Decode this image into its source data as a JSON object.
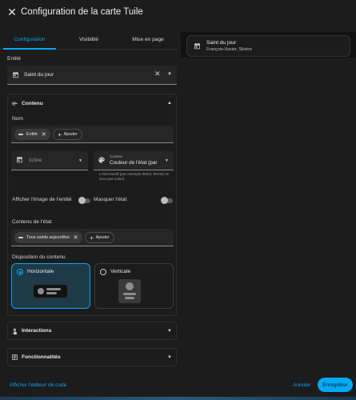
{
  "dialog": {
    "title": "Configuration de la carte Tuile",
    "close_icon": "close-icon"
  },
  "tabs": [
    {
      "label": "Configuration",
      "active": true
    },
    {
      "label": "Visibilité",
      "active": false
    },
    {
      "label": "Mise en page",
      "active": false
    }
  ],
  "entity": {
    "label": "Entité",
    "value": "Saint du jour",
    "icon": "calendar-icon"
  },
  "content_section": {
    "title": "Contenu",
    "name_label": "Nom",
    "name_chip": "Entité",
    "name_add": "Ajouter",
    "icon_placeholder": "Icône",
    "color_label": "Couleur",
    "color_value": "Couleur de l'état (par",
    "color_helper": "L'état inactif (par exemple éteint, fermé) ne sera pas coloré.",
    "show_image_label": "Afficher l'image de l'entité",
    "hide_state_label": "Masquer l'état",
    "state_content_label": "Contenu de l'état",
    "state_chip": "Tous saints aujourdhui",
    "state_add": "Ajouter",
    "layout_label": "Disposition du contenu",
    "layout_horizontal": "Horizontale",
    "layout_vertical": "Verticale"
  },
  "interactions": {
    "title": "Interactions"
  },
  "features": {
    "title": "Fonctionnalités"
  },
  "footer": {
    "show_code": "Afficher l'éditeur de code",
    "cancel": "Annuler",
    "save": "Enregistrer"
  },
  "preview": {
    "title": "Saint du jour",
    "subtitle": "François-Xavier, Silvère"
  },
  "colors": {
    "accent": "#03a9f4",
    "background": "#1c1c1c",
    "selected_option": "#1e3a47"
  }
}
